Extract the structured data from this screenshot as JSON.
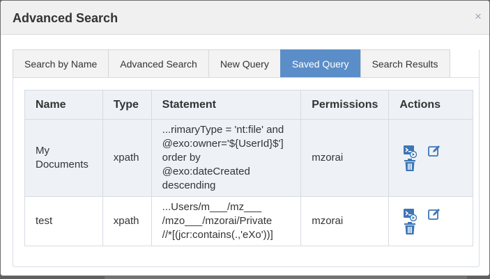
{
  "dialog": {
    "title": "Advanced Search",
    "close_symbol": "×"
  },
  "tabs": [
    {
      "label": "Search by Name",
      "active": false
    },
    {
      "label": "Advanced Search",
      "active": false
    },
    {
      "label": "New Query",
      "active": false
    },
    {
      "label": "Saved Query",
      "active": true
    },
    {
      "label": "Search Results",
      "active": false
    }
  ],
  "table": {
    "headers": {
      "name": "Name",
      "type": "Type",
      "statement": "Statement",
      "permissions": "Permissions",
      "actions": "Actions"
    },
    "rows": [
      {
        "name_line1": "My",
        "name_line2": "Documents",
        "type": "xpath",
        "statement_lines": [
          "...rimaryType = 'nt:file' and",
          "@exo:owner='${UserId}$']",
          "order by",
          "@exo:dateCreated",
          "descending"
        ],
        "permissions": "mzorai"
      },
      {
        "name_line1": "test",
        "name_line2": "",
        "type": "xpath",
        "statement_lines": [
          "...Users/m___/mz___",
          "/mzo___/mzorai/Private",
          "//*[(jcr:contains(.,'eXo'))]"
        ],
        "permissions": "mzorai"
      }
    ],
    "action_icons": [
      "execute-query-icon",
      "edit-icon",
      "delete-icon"
    ]
  },
  "colors": {
    "accent": "#5b8ec8",
    "icon": "#3d76b5",
    "header_bg": "#f0f0f0",
    "row_bg": "#eef2f7"
  }
}
